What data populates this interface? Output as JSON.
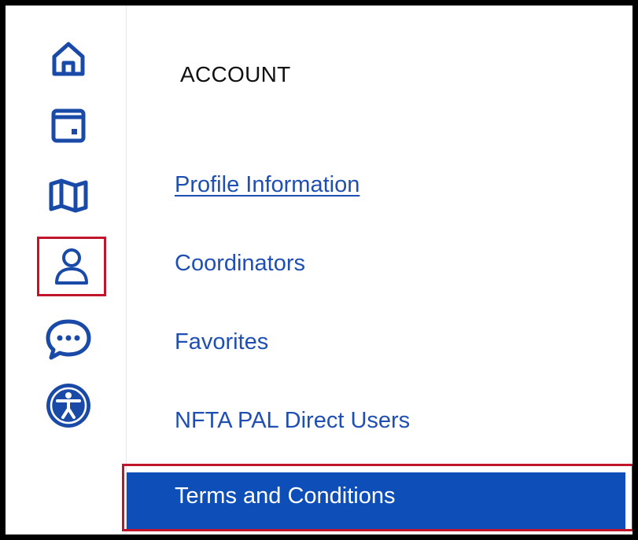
{
  "sidebar": {
    "icons": [
      {
        "name": "home-icon"
      },
      {
        "name": "calendar-icon"
      },
      {
        "name": "map-icon"
      },
      {
        "name": "account-icon",
        "highlighted": true
      },
      {
        "name": "chat-icon"
      },
      {
        "name": "accessibility-icon"
      }
    ],
    "icon_color": "#1a4aa8",
    "highlight_color": "#c0152a"
  },
  "account_menu": {
    "title": "ACCOUNT",
    "items": [
      {
        "label": "Profile Information"
      },
      {
        "label": "Coordinators"
      },
      {
        "label": "Favorites"
      },
      {
        "label": "NFTA PAL Direct Users"
      },
      {
        "label": "Terms and Conditions",
        "selected": true
      }
    ],
    "link_color": "#1f4fb3",
    "selected_bg": "#0e4eb8"
  }
}
